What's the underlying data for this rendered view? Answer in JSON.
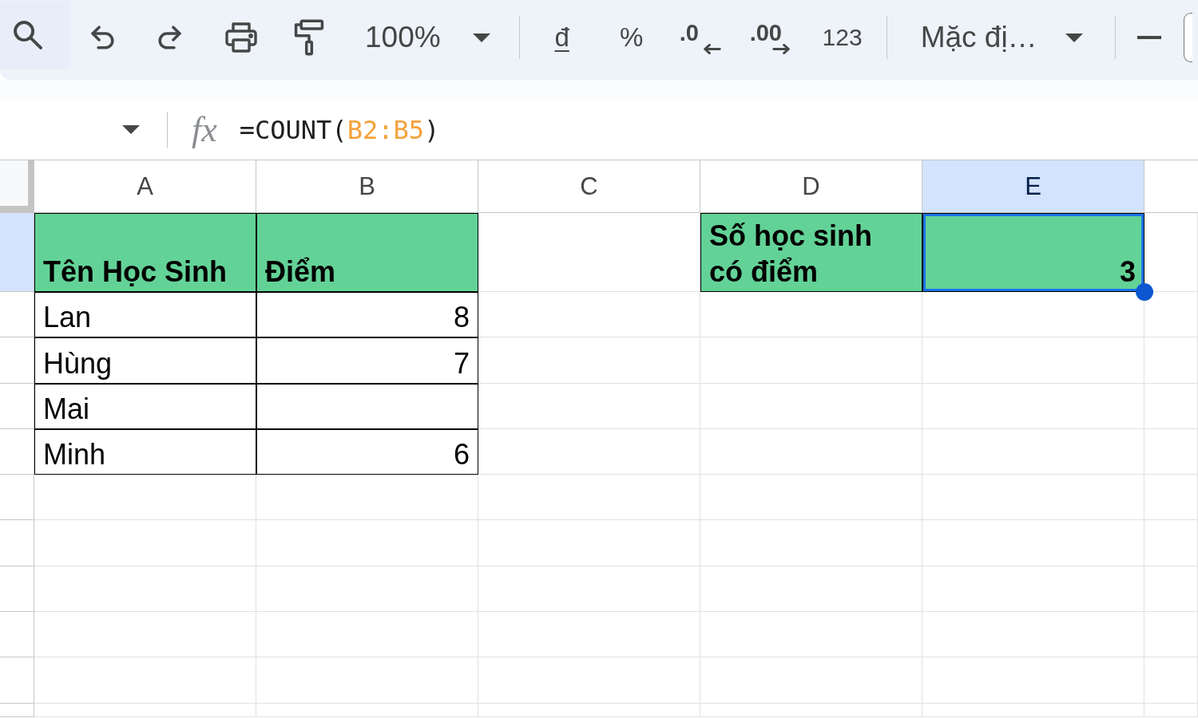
{
  "toolbar": {
    "zoom": "100%",
    "currency_format": "đ",
    "percent_format": "%",
    "decrease_decimal": ".0",
    "increase_decimal": ".00",
    "number_format": "123",
    "font": "Mặc đị…"
  },
  "formula_bar": {
    "function_label": "fx",
    "formula": [
      {
        "kind": "text",
        "text": "=COUNT("
      },
      {
        "kind": "reference",
        "text": "B2:B5"
      },
      {
        "kind": "text",
        "text": ")"
      }
    ]
  },
  "sheet": {
    "columns": [
      {
        "label": "A",
        "selected": false
      },
      {
        "label": "B",
        "selected": false
      },
      {
        "label": "C",
        "selected": false
      },
      {
        "label": "D",
        "selected": false
      },
      {
        "label": "E",
        "selected": true
      }
    ],
    "rows": [
      {
        "selected": true,
        "cells": [
          {
            "kind": "heading",
            "text": "Tên Học Sinh",
            "selected": false
          },
          {
            "kind": "heading",
            "text": "Điểm",
            "selected": false
          },
          {
            "kind": "blank",
            "selected": false
          },
          {
            "kind": "heading",
            "text": "Số học sinh có điểm",
            "selected": false
          },
          {
            "kind": "result",
            "text": "3",
            "selected": true
          }
        ]
      },
      {
        "selected": false,
        "cells": [
          {
            "kind": "text",
            "text": "Lan",
            "selected": false
          },
          {
            "kind": "number",
            "text": "8",
            "selected": false
          }
        ]
      },
      {
        "selected": false,
        "cells": [
          {
            "kind": "text",
            "text": "Hùng",
            "selected": false
          },
          {
            "kind": "number",
            "text": "7",
            "selected": false
          }
        ]
      },
      {
        "selected": false,
        "cells": [
          {
            "kind": "text",
            "text": "Mai",
            "selected": false
          },
          {
            "kind": "number",
            "selected": false
          }
        ]
      },
      {
        "selected": false,
        "cells": [
          {
            "kind": "text",
            "text": "Minh",
            "selected": false
          },
          {
            "kind": "number",
            "text": "6",
            "selected": false
          }
        ]
      },
      {
        "selected": false
      },
      {
        "selected": false
      },
      {
        "selected": false
      },
      {
        "selected": false
      },
      {
        "selected": false
      },
      {
        "selected": false
      }
    ]
  }
}
